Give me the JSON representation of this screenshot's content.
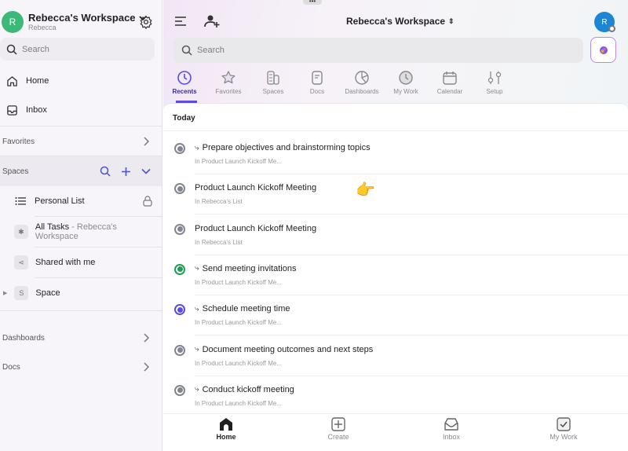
{
  "sidebar": {
    "avatar_initial": "R",
    "workspace_name": "Rebecca's Workspace",
    "user_name": "Rebecca",
    "search_placeholder": "Search",
    "home": "Home",
    "inbox": "Inbox",
    "favorites": "Favorites",
    "spaces": "Spaces",
    "personal_list": "Personal List",
    "all_tasks": "All Tasks",
    "all_tasks_suffix": "- Rebecca's Workspace",
    "shared": "Shared with me",
    "space_initial": "S",
    "space": "Space",
    "dashboards": "Dashboards",
    "docs": "Docs"
  },
  "header": {
    "workspace_title": "Rebecca's Workspace",
    "avatar_initial": "R",
    "search_placeholder": "Search"
  },
  "tabs": [
    "Recents",
    "Favorites",
    "Spaces",
    "Docs",
    "Dashboards",
    "My Work",
    "Calendar",
    "Setup"
  ],
  "section_title": "Today",
  "items": [
    {
      "title": "Prepare objectives and brainstorming topics",
      "sub": "In Product Launch Kickoff Me...",
      "subtask": true,
      "status": "gray"
    },
    {
      "title": "Product Launch Kickoff Meeting",
      "sub": "In Rebecca's List",
      "subtask": false,
      "status": "gray"
    },
    {
      "title": "Product Launch Kickoff Meeting",
      "sub": "In Rebecca's List",
      "subtask": false,
      "status": "gray"
    },
    {
      "title": "Send meeting invitations",
      "sub": "In Product Launch Kickoff Me...",
      "subtask": true,
      "status": "green"
    },
    {
      "title": "Schedule meeting time",
      "sub": "In Product Launch Kickoff Me...",
      "subtask": true,
      "status": "purple"
    },
    {
      "title": "Document meeting outcomes and next steps",
      "sub": "In Product Launch Kickoff Me...",
      "subtask": true,
      "status": "gray"
    },
    {
      "title": "Conduct kickoff meeting",
      "sub": "In Product Launch Kickoff Me...",
      "subtask": true,
      "status": "gray"
    }
  ],
  "status_colors": {
    "gray": "#808590",
    "green": "#1f9d55",
    "purple": "#5b4ce0"
  },
  "bottom_nav": {
    "home": "Home",
    "create": "Create",
    "inbox": "Inbox",
    "my_work": "My Work"
  }
}
